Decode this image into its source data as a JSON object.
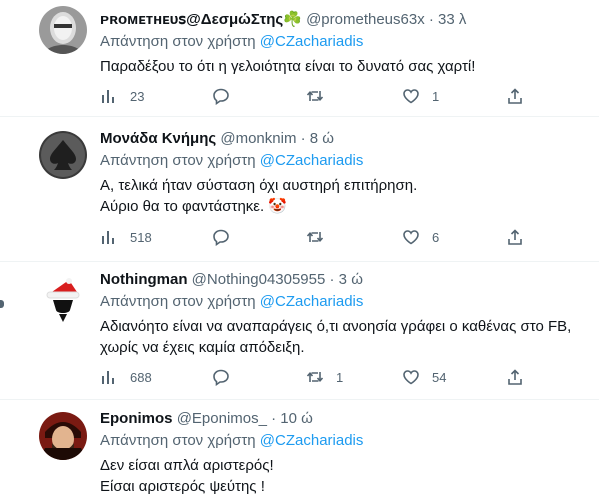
{
  "reply_prefix": "Απάντηση στον χρήστη",
  "tweets": [
    {
      "name": "ᴘʀᴏᴍᴇᴛʜᴇᴜꜱ@ΔεσμώΣτης☘️",
      "handle": "@prometheus63x",
      "time": "· 33 λ",
      "mention": "@CZachariadis",
      "text": "Παραδέξου το ότι η γελοιότητα είναι το δυνατό σας χαρτί!",
      "views": "23",
      "replies": "",
      "retweets": "",
      "likes": "1"
    },
    {
      "name": "Μονάδα Κνήμης",
      "handle": "@monknim",
      "time": "· 8 ώ",
      "mention": "@CZachariadis",
      "text": "Α, τελικά ήταν σύσταση όχι αυστηρή επιτήρηση.\nΑύριο θα το φαντάστηκε. 🤡",
      "views": "518",
      "replies": "",
      "retweets": "",
      "likes": "6"
    },
    {
      "name": "Nothingman",
      "handle": "@Nothing04305955",
      "time": "· 3 ώ",
      "mention": "@CZachariadis",
      "text": "Αδιανόητο είναι να αναπαράγεις ό,τι ανοησία γράφει ο καθένας στο FB,\nχωρίς να έχεις καμία απόδειξη.",
      "views": "688",
      "replies": "",
      "retweets": "1",
      "likes": "54"
    },
    {
      "name": "Eponimos",
      "handle": "@Eponimos_",
      "time": "· 10 ώ",
      "mention": "@CZachariadis",
      "text": "Δεν είσαι απλά αριστερός!\nΕίσαι αριστερός  ψεύτης !",
      "views": "",
      "replies": "",
      "retweets": "",
      "likes": ""
    }
  ],
  "colors": {
    "text": "#0f1419",
    "muted": "#536471",
    "link": "#1d9bf0",
    "divider": "#eff3f4"
  },
  "icons": [
    "views-icon",
    "reply-icon",
    "retweet-icon",
    "like-icon",
    "share-icon"
  ]
}
